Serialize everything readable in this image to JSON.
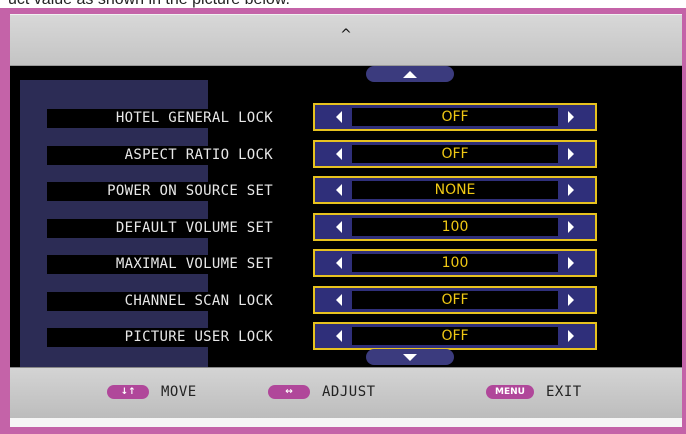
{
  "caption": "uct value as shown in the picture below.",
  "top_bar": {
    "caret_glyph": "^"
  },
  "scroll": {
    "up_icon": "triangle-up-icon",
    "down_icon": "triangle-down-icon"
  },
  "menu_items": [
    {
      "label": "HOTEL GENERAL LOCK",
      "value": "OFF"
    },
    {
      "label": "ASPECT RATIO LOCK",
      "value": "OFF"
    },
    {
      "label": "POWER ON SOURCE SET",
      "value": "NONE"
    },
    {
      "label": "DEFAULT VOLUME SET",
      "value": "100"
    },
    {
      "label": "MAXIMAL VOLUME SET",
      "value": "100"
    },
    {
      "label": "CHANNEL SCAN LOCK",
      "value": "OFF"
    },
    {
      "label": "PICTURE USER LOCK",
      "value": "OFF"
    }
  ],
  "bottom_hints": {
    "move": {
      "key": "↓↑",
      "label": "MOVE"
    },
    "adjust": {
      "key": "↔",
      "label": "ADJUST"
    },
    "exit": {
      "key": "MENU",
      "label": "EXIT"
    }
  },
  "colors": {
    "frame": "#c463a8",
    "value_text": "#f0c814",
    "value_border": "#e7c21f",
    "value_bg": "#2f2f7a",
    "key_pill": "#b0479a"
  }
}
